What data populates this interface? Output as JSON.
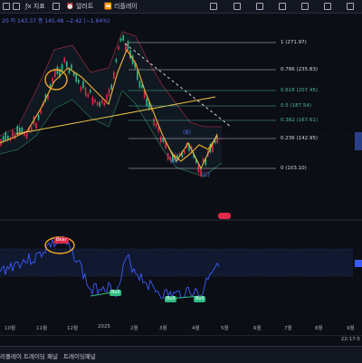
{
  "toolbar": {
    "indicator_label": "지표",
    "alert_label": "얼러트",
    "replay_label": "리플레이"
  },
  "legend": {
    "text": "20 저 143.37 종 145.48 −2.42 (−1.64%)"
  },
  "fib_levels": [
    {
      "label": "1 (271.97)",
      "teal": false
    },
    {
      "label": "0.786 (235.83)",
      "teal": false
    },
    {
      "label": "0.618 (207.45)",
      "teal": true
    },
    {
      "label": "0.5 (187.54)",
      "teal": true
    },
    {
      "label": "0.382 (167.61)",
      "teal": true
    },
    {
      "label": "0.236 (142.95)",
      "teal": false
    },
    {
      "label": "0 (103.10)",
      "teal": false
    }
  ],
  "wave_labels": {
    "a": "(A)",
    "b": "(B)",
    "c": "(C)"
  },
  "badges": {
    "bear": "Bear",
    "bull1": "Bull",
    "bull2": "Bull",
    "bull3": "Bull"
  },
  "x_axis": [
    "10월",
    "11월",
    "12월",
    "2025",
    "2월",
    "3월",
    "4월",
    "5월",
    "6월",
    "7월",
    "8월",
    "9월"
  ],
  "time_display": "22:17:5",
  "bottom_bar": {
    "tab1": "리플레이 트레이딩 패널",
    "tab2": "트레이딩패널"
  },
  "colors": {
    "background": "#0b0e14",
    "candle_up": "#2ebd85",
    "candle_down": "#e0294a",
    "rsi_line": "#3b5bff",
    "trendline": "#e8c547",
    "annotation": "#f5a623"
  }
}
